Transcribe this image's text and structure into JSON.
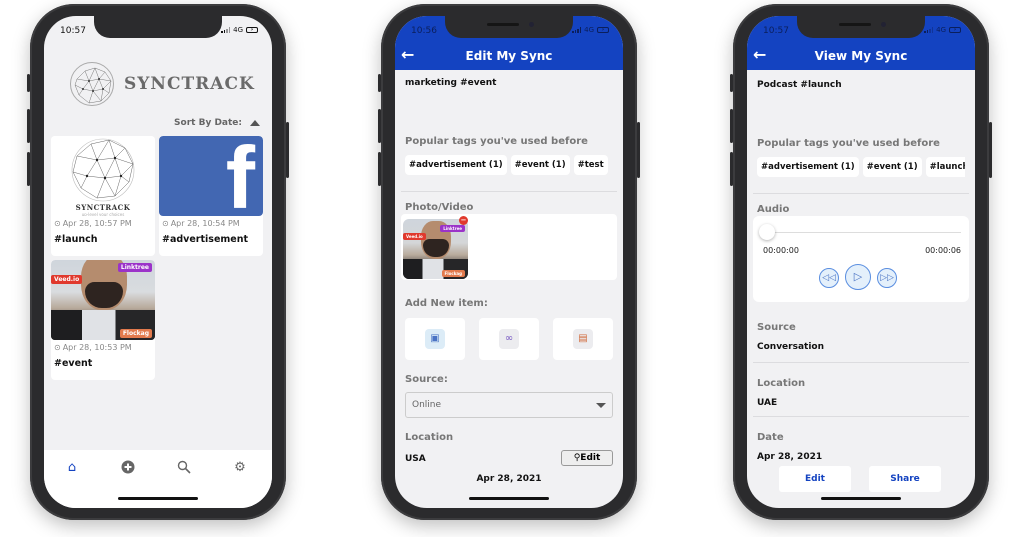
{
  "phone_home": {
    "status": {
      "time": "10:57",
      "network": "4G"
    },
    "brand": "SYNCTRACK",
    "brand_tagline": "up-level your choices",
    "sort_label": "Sort By Date:",
    "cards": [
      {
        "thumb": "synctrack-logo",
        "timestamp": "Apr 28, 10:57 PM",
        "tag": "#launch"
      },
      {
        "thumb": "facebook-logo",
        "timestamp": "Apr 28, 10:54 PM",
        "tag": "#advertisement"
      },
      {
        "thumb": "video-person",
        "timestamp": "Apr 28, 10:53 PM",
        "tag": "#event",
        "overlays": [
          "Veed.io",
          "Linktree",
          "Flockag"
        ]
      }
    ],
    "tabs": [
      {
        "icon": "home-icon",
        "active": true
      },
      {
        "icon": "add-circle-icon",
        "active": false
      },
      {
        "icon": "search-icon",
        "active": false
      },
      {
        "icon": "gear-icon",
        "active": false
      }
    ]
  },
  "phone_edit": {
    "status": {
      "time": "10:56",
      "network": "4G"
    },
    "title": "Edit My Sync",
    "description": "marketing #event",
    "popular_tags_label": "Popular tags you've used before",
    "popular_tags": [
      "#advertisement (1)",
      "#event (1)",
      "#test"
    ],
    "photo_video_label": "Photo/Video",
    "add_new_label": "Add New item:",
    "add_items": [
      "image-icon",
      "link-icon",
      "document-icon"
    ],
    "source_label": "Source:",
    "source_value": "Online",
    "location_label": "Location",
    "location_value": "USA",
    "edit_location_label": "Edit",
    "date_value": "Apr 28, 2021"
  },
  "phone_view": {
    "status": {
      "time": "10:57",
      "network": "4G"
    },
    "title": "View My Sync",
    "description": "Podcast #launch",
    "popular_tags_label": "Popular tags you've used before",
    "popular_tags": [
      "#advertisement (1)",
      "#event (1)",
      "#launch"
    ],
    "audio_label": "Audio",
    "audio": {
      "current": "00:00:00",
      "duration": "00:00:06",
      "progress": 0
    },
    "source_label": "Source",
    "source_value": "Conversation",
    "location_label": "Location",
    "location_value": "UAE",
    "date_label": "Date",
    "date_value": "Apr 28, 2021",
    "edit_label": "Edit",
    "share_label": "Share"
  },
  "colors": {
    "primary": "#1443c1",
    "facebook": "#4267b2",
    "screen_bg": "#f1f1f3"
  }
}
